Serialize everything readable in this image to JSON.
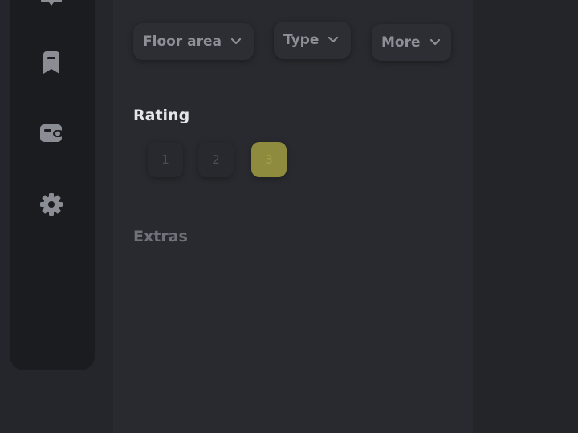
{
  "filters": {
    "chips": [
      {
        "label": "Floor area"
      },
      {
        "label": "Type"
      },
      {
        "label": "More"
      }
    ]
  },
  "rating": {
    "title": "Rating",
    "options": [
      "1",
      "2",
      "3"
    ],
    "selected": "3"
  },
  "extras": {
    "title": "Extras"
  },
  "sidebar": {
    "icons": [
      "chat-icon",
      "bookmark-icon",
      "wallet-icon",
      "settings-gear-icon"
    ]
  },
  "colors": {
    "background": "#24262b",
    "panel": "#282a2f",
    "sidebar": "#1b1c20",
    "icon": "#8a8d93",
    "accent_selected": "#8e8b3e",
    "title_text": "#e4e5e8",
    "muted_title": "#6f7278"
  }
}
